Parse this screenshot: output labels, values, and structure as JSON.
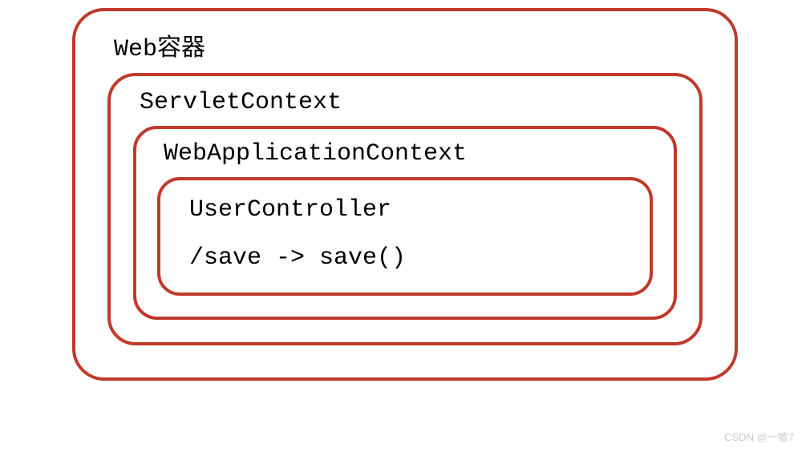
{
  "diagram": {
    "level1": {
      "label": "Web容器"
    },
    "level2": {
      "label": "ServletContext"
    },
    "level3": {
      "label": "WebApplicationContext"
    },
    "level4": {
      "label": "UserController",
      "mapping": "/save -> save()"
    }
  },
  "watermark": "CSDN @一嘘7"
}
